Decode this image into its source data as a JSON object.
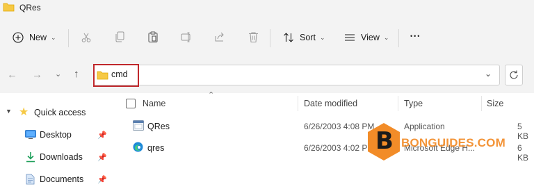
{
  "window": {
    "title": "QRes"
  },
  "toolbar": {
    "new_label": "New",
    "sort_label": "Sort",
    "view_label": "View",
    "more_label": "•••"
  },
  "address": {
    "path": "cmd"
  },
  "sidebar": {
    "items": [
      {
        "label": "Quick access"
      },
      {
        "label": "Desktop"
      },
      {
        "label": "Downloads"
      },
      {
        "label": "Documents"
      }
    ]
  },
  "list": {
    "headers": {
      "name": "Name",
      "date": "Date modified",
      "type": "Type",
      "size": "Size"
    },
    "rows": [
      {
        "name": "QRes",
        "date": "6/26/2003 4:08 PM",
        "type": "Application",
        "size": "5 KB"
      },
      {
        "name": "qres",
        "date": "6/26/2003 4:02 PM",
        "type": "Microsoft Edge H...",
        "size": "6 KB"
      }
    ]
  },
  "watermark": {
    "letter": "B",
    "text": "BONGUIDES.COM"
  },
  "colors": {
    "highlight": "#c0282c",
    "folder": "#f6c945",
    "accent": "#0067c0",
    "watermark": "#f28c28"
  }
}
